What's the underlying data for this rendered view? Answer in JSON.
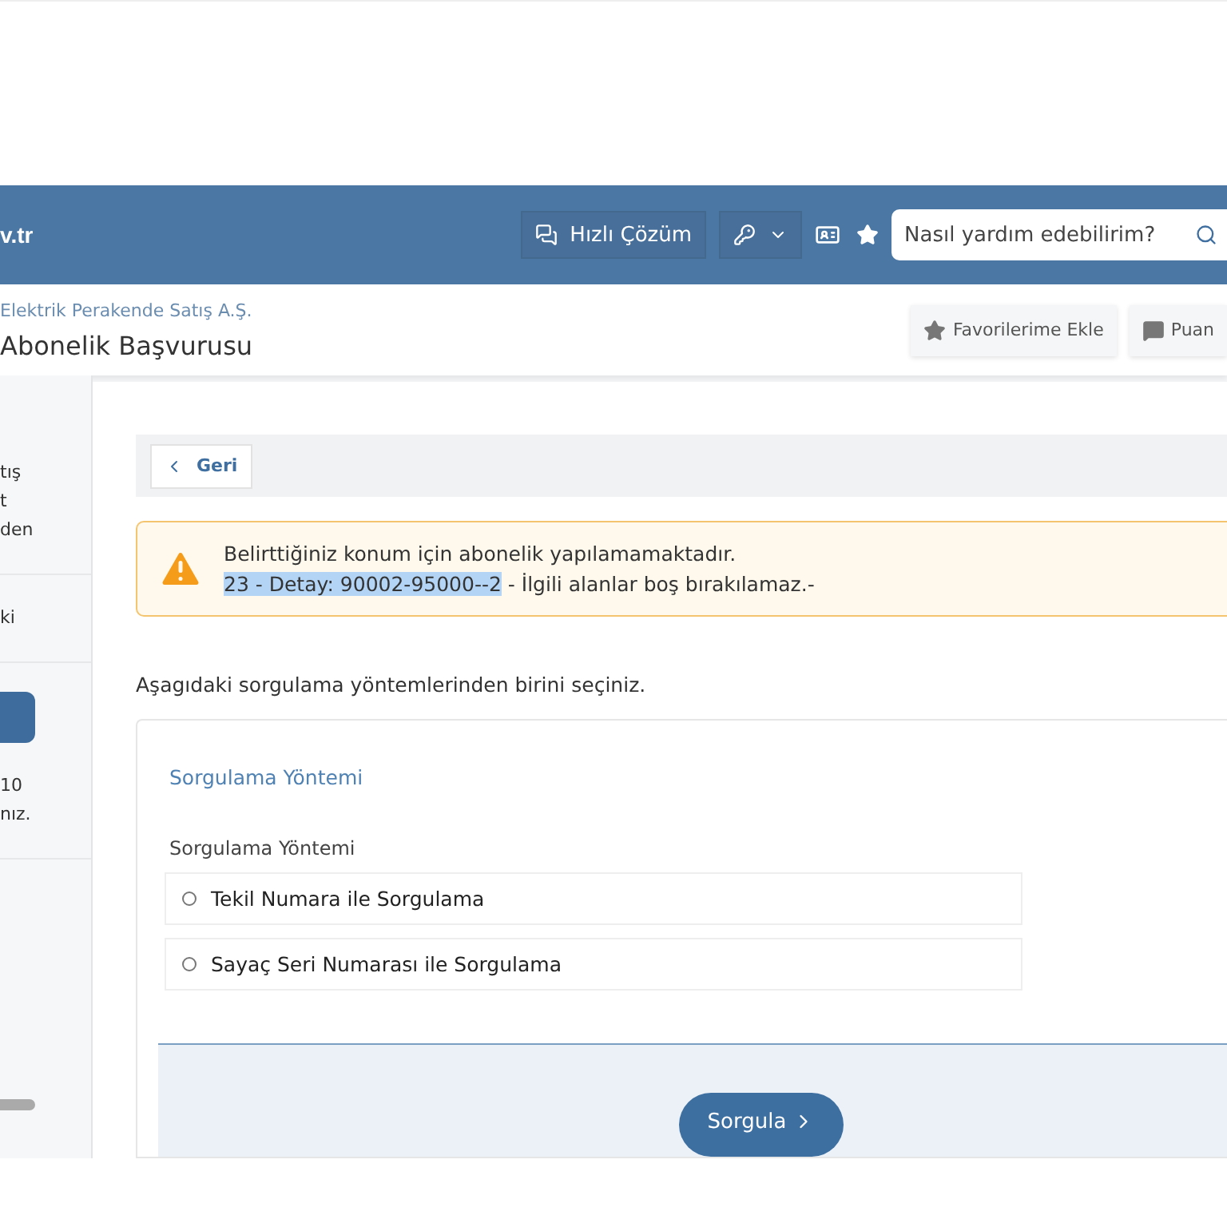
{
  "header": {
    "logo": "v.tr",
    "quick_solution": "Hızlı Çözüm",
    "search": {
      "placeholder": "Nasıl yardım edebilirim?"
    }
  },
  "subheader": {
    "company": "Elektrik Perakende Satış A.Ş.",
    "title": "Abonelik Başvurusu",
    "actions": [
      "Favorilerime Ekle",
      "Puan"
    ]
  },
  "sidebar": {
    "items": [
      {
        "kind": "text",
        "lines": [
          "tış",
          "t",
          "den"
        ]
      },
      {
        "kind": "text",
        "lines": [
          "ki"
        ]
      },
      {
        "kind": "button"
      },
      {
        "kind": "text",
        "lines": [
          "10",
          "nız."
        ]
      }
    ]
  },
  "back_button": "Geri",
  "alert": {
    "line1": "Belirttiğiniz konum için abonelik yapılamamaktadır.",
    "line2": [
      {
        "text": "23 - Detay: 90002-95000--2",
        "highlighted": true
      },
      {
        "text": " - İlgili alanlar boş bırakılamaz.-",
        "highlighted": false
      }
    ]
  },
  "instruction": "Aşagıdaki sorgulama yöntemlerinden birini seçiniz.",
  "card": {
    "title": "Sorgulama Yöntemi",
    "label": "Sorgulama Yöntemi",
    "options": [
      {
        "label": "Tekil Numara ile Sorgulama",
        "selected": false
      },
      {
        "label": "Sayaç Seri Numarası ile Sorgulama",
        "selected": false
      }
    ],
    "submit": "Sorgula"
  }
}
